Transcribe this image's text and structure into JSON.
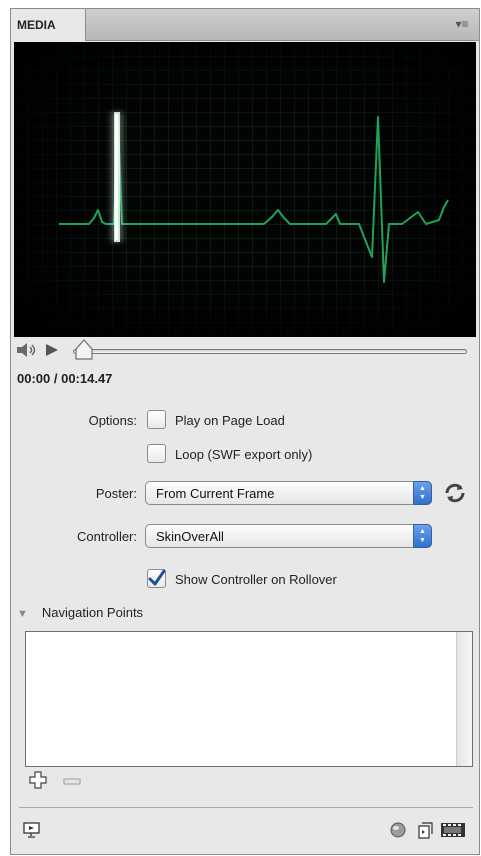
{
  "panel": {
    "tab_label": "MEDIA",
    "menu_icon": "panel-menu-icon"
  },
  "player": {
    "timecode": "00:00 / 00:14.47",
    "scrubber_position": 0
  },
  "options": {
    "label": "Options:",
    "play_on_page_load": {
      "label": "Play on Page Load",
      "checked": false
    },
    "loop": {
      "label": "Loop (SWF export only)",
      "checked": false
    }
  },
  "poster": {
    "label": "Poster:",
    "value": "From Current Frame"
  },
  "controller": {
    "label": "Controller:",
    "value": "SkinOverAll",
    "show_on_rollover": {
      "label": "Show Controller on Rollover",
      "checked": true
    }
  },
  "navigation_points": {
    "header": "Navigation Points",
    "items": []
  },
  "colors": {
    "accent": "#2d6fd4",
    "waveform": "#1fa35a"
  }
}
